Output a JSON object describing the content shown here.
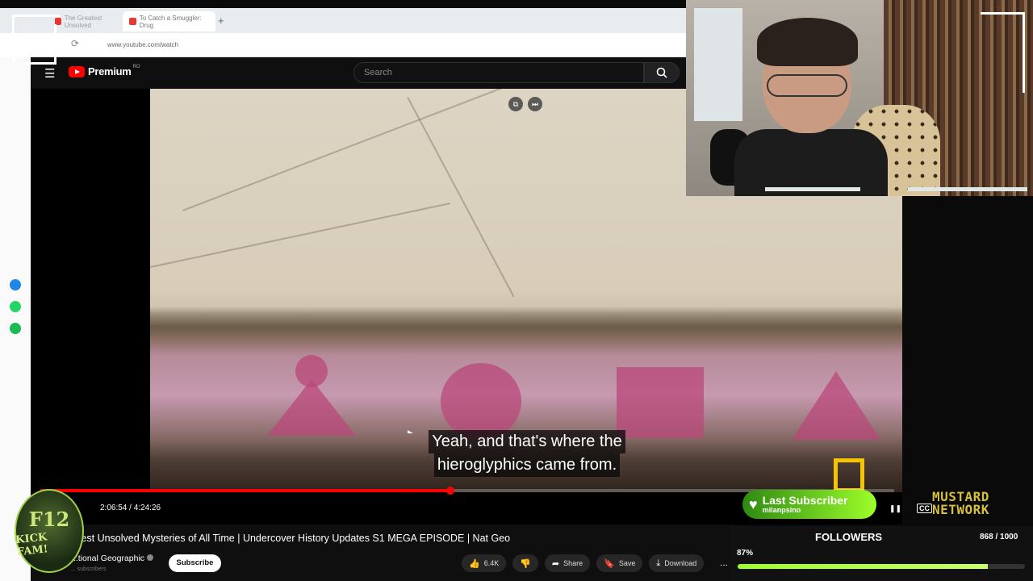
{
  "browser": {
    "tabs": [
      {
        "label": "The Greatest Unsolved"
      },
      {
        "label": "To Catch a Smuggler: Drug"
      }
    ],
    "new_tab": "+",
    "url": "www.youtube.com/watch"
  },
  "youtube": {
    "logo_text": "Premium",
    "region": "RO",
    "search_placeholder": "Search"
  },
  "video": {
    "caption_line1": "Yeah, and that's where the",
    "caption_line2": "hieroglyphics came from.",
    "time": "2:06:54 / 4:24:26",
    "progress_fraction": 0.48,
    "cc_label": "CC",
    "title": "...est Unsolved Mysteries of All Time | Undercover History Updates S1 MEGA EPISODE | Nat Geo",
    "channel": "...tional Geographic",
    "subscribers": "... subscribers",
    "subscribe_label": "Subscribe",
    "like_count": "6.4K",
    "share_label": "Share",
    "save_label": "Save",
    "download_label": "Download",
    "more_label": "..."
  },
  "overlay": {
    "f12_line1": "F12",
    "f12_line2": "KICK FAM!",
    "last_sub_label": "Last Subscriber",
    "last_sub_name": "milanpsino",
    "brand_line1": "MUSTARD",
    "brand_line2": "NETWORK",
    "followers_label": "FOLLOWERS",
    "followers_count": "868 / 1000",
    "followers_pct": "87%",
    "followers_fraction": 0.87
  },
  "colors": {
    "yt_red": "#ff0000",
    "accent_green": "#9dff2a",
    "brand_mustard": "#d8c13a",
    "natgeo_yellow": "#f5c400"
  }
}
